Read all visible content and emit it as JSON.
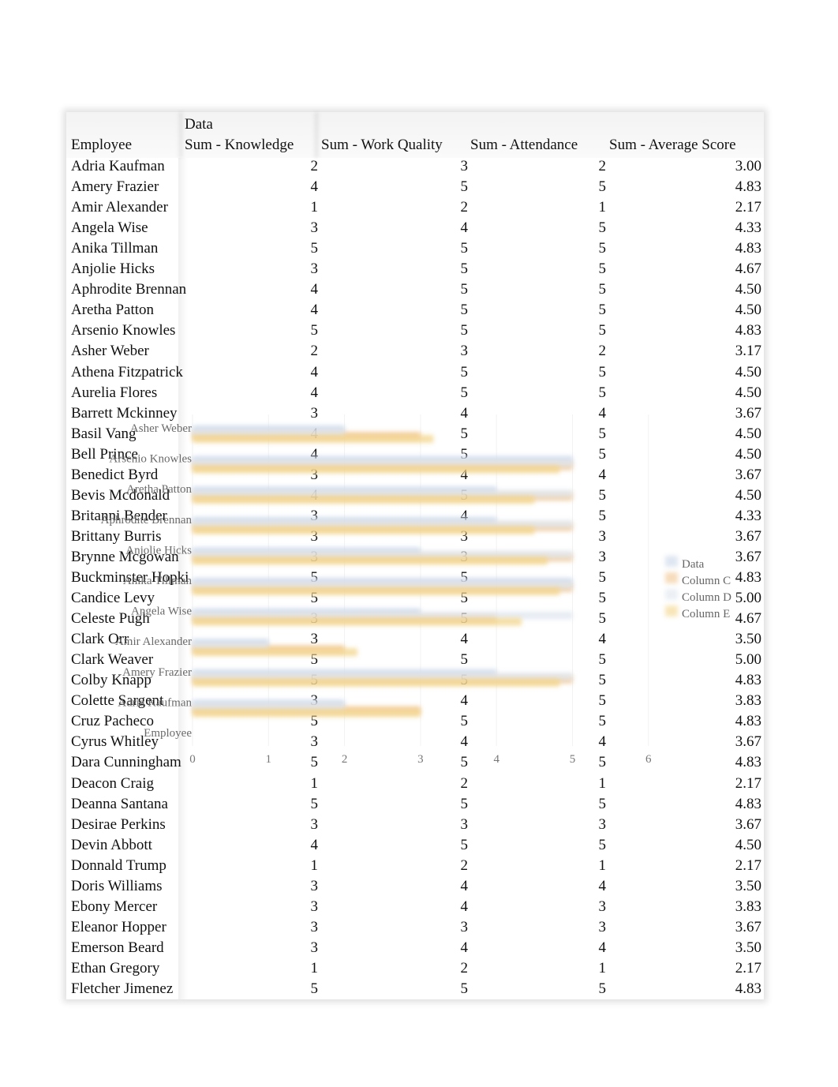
{
  "pivot": {
    "data_header": "Data",
    "columns": [
      "Employee",
      "Sum - Knowledge",
      "Sum - Work Quality",
      "Sum - Attendance",
      "Sum - Average Score"
    ],
    "rows": [
      [
        "Adria Kaufman",
        "2",
        "3",
        "2",
        "3.00"
      ],
      [
        "Amery Frazier",
        "4",
        "5",
        "5",
        "4.83"
      ],
      [
        "Amir Alexander",
        "1",
        "2",
        "1",
        "2.17"
      ],
      [
        "Angela Wise",
        "3",
        "4",
        "5",
        "4.33"
      ],
      [
        "Anika Tillman",
        "5",
        "5",
        "5",
        "4.83"
      ],
      [
        "Anjolie Hicks",
        "3",
        "5",
        "5",
        "4.67"
      ],
      [
        "Aphrodite Brennan",
        "4",
        "5",
        "5",
        "4.50"
      ],
      [
        "Aretha Patton",
        "4",
        "5",
        "5",
        "4.50"
      ],
      [
        "Arsenio Knowles",
        "5",
        "5",
        "5",
        "4.83"
      ],
      [
        "Asher Weber",
        "2",
        "3",
        "2",
        "3.17"
      ],
      [
        "Athena Fitzpatrick",
        "4",
        "5",
        "5",
        "4.50"
      ],
      [
        "Aurelia Flores",
        "4",
        "5",
        "5",
        "4.50"
      ],
      [
        "Barrett Mckinney",
        "3",
        "4",
        "4",
        "3.67"
      ],
      [
        "Basil Vang",
        "4",
        "5",
        "5",
        "4.50"
      ],
      [
        "Bell Prince",
        "4",
        "5",
        "5",
        "4.50"
      ],
      [
        "Benedict Byrd",
        "3",
        "4",
        "4",
        "3.67"
      ],
      [
        "Bevis Mcdonald",
        "4",
        "5",
        "5",
        "4.50"
      ],
      [
        "Britanni Bender",
        "3",
        "4",
        "5",
        "4.33"
      ],
      [
        "Brittany Burris",
        "3",
        "3",
        "3",
        "3.67"
      ],
      [
        "Brynne Mcgowan",
        "3",
        "3",
        "3",
        "3.67"
      ],
      [
        "Buckminster Hopki",
        "5",
        "5",
        "5",
        "4.83"
      ],
      [
        "Candice Levy",
        "5",
        "5",
        "5",
        "5.00"
      ],
      [
        "Celeste Pugh",
        "3",
        "5",
        "5",
        "4.67"
      ],
      [
        "Clark Orr",
        "3",
        "4",
        "4",
        "3.50"
      ],
      [
        "Clark Weaver",
        "5",
        "5",
        "5",
        "5.00"
      ],
      [
        "Colby Knapp",
        "5",
        "5",
        "5",
        "4.83"
      ],
      [
        "Colette Sargent",
        "3",
        "4",
        "5",
        "3.83"
      ],
      [
        "Cruz Pacheco",
        "5",
        "5",
        "5",
        "4.83"
      ],
      [
        "Cyrus Whitley",
        "3",
        "4",
        "4",
        "3.67"
      ],
      [
        "Dara Cunningham",
        "5",
        "5",
        "5",
        "4.83"
      ],
      [
        "Deacon Craig",
        "1",
        "2",
        "1",
        "2.17"
      ],
      [
        "Deanna Santana",
        "5",
        "5",
        "5",
        "4.83"
      ],
      [
        "Desirae Perkins",
        "3",
        "3",
        "3",
        "3.67"
      ],
      [
        "Devin Abbott",
        "4",
        "5",
        "5",
        "4.50"
      ],
      [
        "Donnald Trump",
        "1",
        "2",
        "1",
        "2.17"
      ],
      [
        "Doris Williams",
        "3",
        "4",
        "4",
        "3.50"
      ],
      [
        "Ebony Mercer",
        "3",
        "4",
        "3",
        "3.83"
      ],
      [
        "Eleanor Hopper",
        "3",
        "3",
        "3",
        "3.67"
      ],
      [
        "Emerson Beard",
        "3",
        "4",
        "4",
        "3.50"
      ],
      [
        "Ethan Gregory",
        "1",
        "2",
        "1",
        "2.17"
      ],
      [
        "Fletcher Jimenez",
        "5",
        "5",
        "5",
        "4.83"
      ]
    ]
  },
  "chart_data": {
    "type": "bar",
    "orientation": "horizontal",
    "title": "",
    "xlabel": "",
    "ylabel": "Employee",
    "xlim": [
      0,
      6
    ],
    "x_ticks": [
      "0",
      "1",
      "2",
      "3",
      "4",
      "5",
      "6"
    ],
    "grid": true,
    "legend_position": "right",
    "categories": [
      "Asher Weber",
      "Arsenio Knowles",
      "Aretha Patton",
      "Aphrodite Brennan",
      "Anjolie Hicks",
      "Anika Tillman",
      "Angela Wise",
      "Amir Alexander",
      "Amery Frazier",
      "Adria Kaufman",
      "Employee"
    ],
    "series": [
      {
        "name": "Data",
        "color": "#c9d6e8",
        "values": [
          2,
          5,
          4,
          4,
          3,
          5,
          3,
          1,
          4,
          2,
          null
        ]
      },
      {
        "name": "Column C",
        "color": "#f0c48e",
        "values": [
          3,
          5,
          5,
          5,
          5,
          5,
          4,
          2,
          5,
          3,
          null
        ]
      },
      {
        "name": "Column D",
        "color": "#dfe6ef",
        "values": [
          2,
          5,
          5,
          5,
          5,
          5,
          5,
          1,
          5,
          2,
          null
        ]
      },
      {
        "name": "Column E",
        "color": "#f3d58a",
        "values": [
          3.17,
          4.83,
          4.5,
          4.5,
          4.67,
          4.83,
          4.33,
          2.17,
          4.83,
          3.0,
          null
        ]
      }
    ]
  }
}
